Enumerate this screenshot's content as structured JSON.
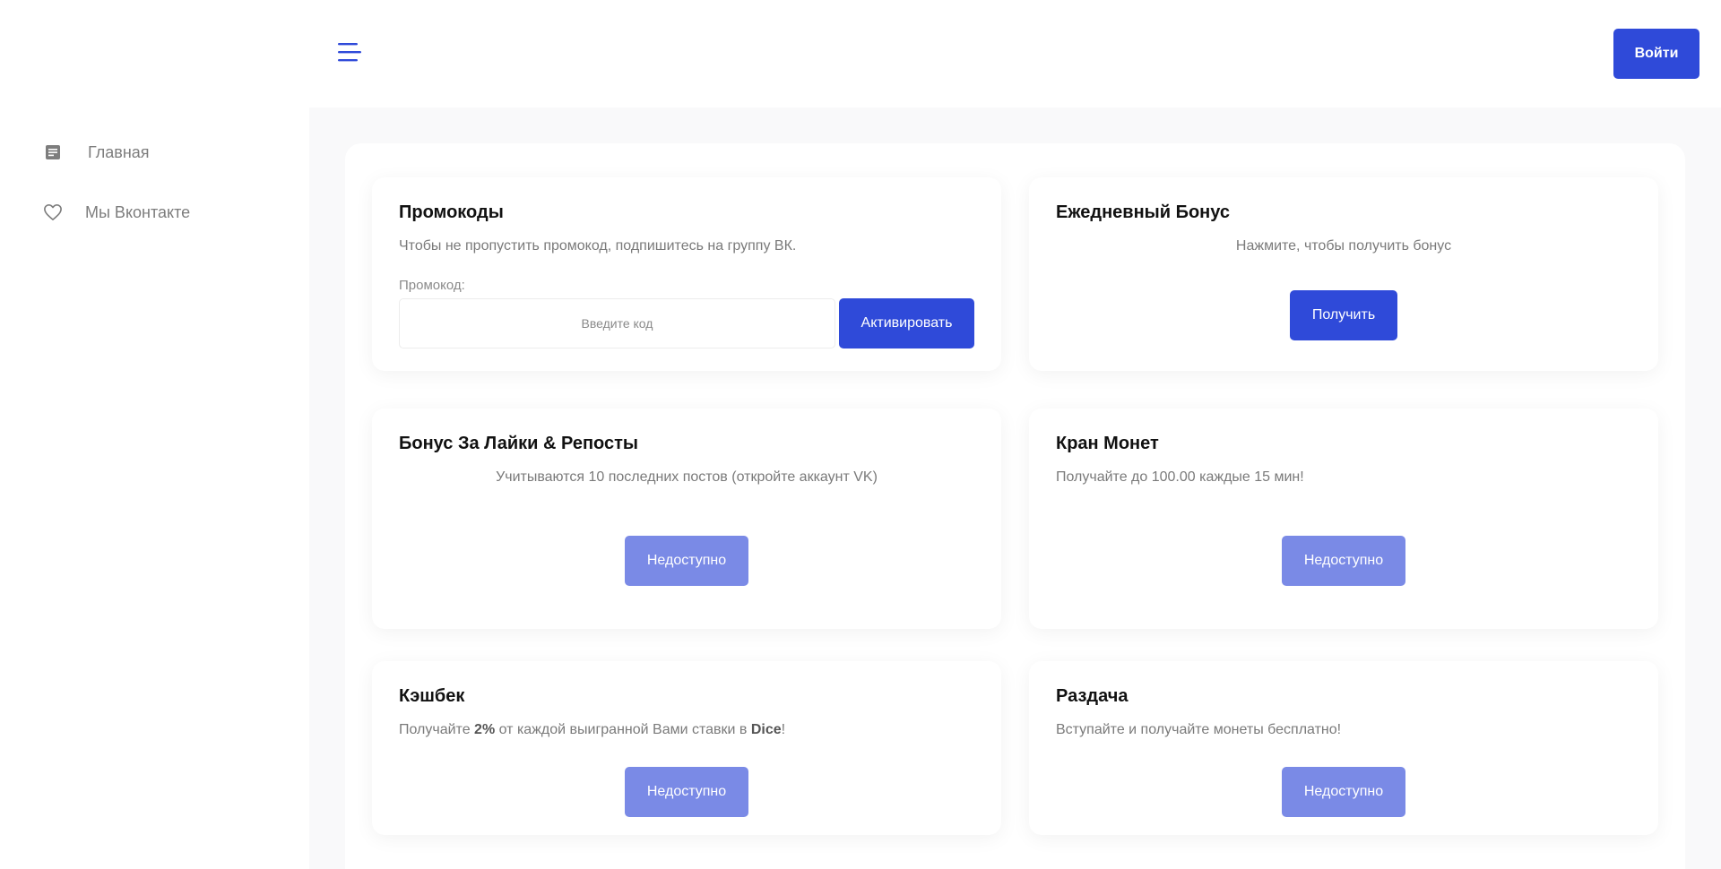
{
  "sidebar": {
    "items": [
      {
        "label": "Главная",
        "icon": "document-icon"
      },
      {
        "label": "Мы Вконтакте",
        "icon": "heart-icon"
      }
    ]
  },
  "header": {
    "menu_icon": "hamburger-icon",
    "login_label": "Войти"
  },
  "cards": {
    "promo": {
      "title": "Промокоды",
      "text": "Чтобы не пропустить промокод, подпишитесь на группу ВК.",
      "input_label": "Промокод:",
      "input_placeholder": "Введите код",
      "input_value": "",
      "button": "Активировать"
    },
    "daily": {
      "title": "Ежедневный Бонус",
      "text": "Нажмите, чтобы получить бонус",
      "button": "Получить"
    },
    "likes": {
      "title": "Бонус За Лайки & Репосты",
      "text": "Учитываются 10 последних постов (откройте аккаунт VK)",
      "button": "Недоступно"
    },
    "faucet": {
      "title": "Кран Монет",
      "text": "Получайте до 100.00 каждые 15 мин!",
      "button": "Недоступно"
    },
    "cashback": {
      "title": "Кэшбек",
      "text_before": "Получайте ",
      "percent": "2%",
      "text_middle": " от каждой выигранной Вами ставки в ",
      "game": "Dice",
      "text_after": "!",
      "button": "Недоступно"
    },
    "giveaway": {
      "title": "Раздача",
      "text": "Вступайте и получайте монеты бесплатно!",
      "button": "Недоступно"
    }
  },
  "colors": {
    "accent": "#2f4ad9",
    "disabled": "#7a8ae6",
    "muted_text": "#7a7a7a"
  }
}
